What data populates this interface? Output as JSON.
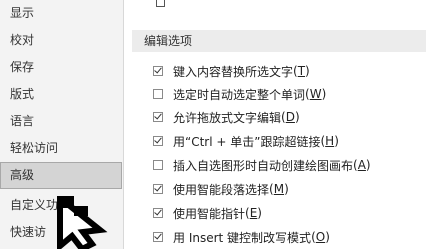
{
  "sidebar": {
    "items": [
      {
        "label": "显示",
        "selected": false
      },
      {
        "label": "校对",
        "selected": false
      },
      {
        "label": "保存",
        "selected": false
      },
      {
        "label": "版式",
        "selected": false
      },
      {
        "label": "语言",
        "selected": false
      },
      {
        "label": "轻松访问",
        "selected": false
      },
      {
        "label": "高级",
        "selected": true
      },
      {
        "label": "自定义功能",
        "selected": false
      },
      {
        "label": "快速访",
        "selected": false
      }
    ]
  },
  "main": {
    "section_title": "编辑选项",
    "options": [
      {
        "label": "键入内容替换所选文字",
        "key": "T",
        "checked": true
      },
      {
        "label": "选定时自动选定整个单词",
        "key": "W",
        "checked": false
      },
      {
        "label": "允许拖放式文字编辑",
        "key": "D",
        "checked": true
      },
      {
        "label": "用“Ctrl + 单击”跟踪超链接",
        "key": "H",
        "checked": true
      },
      {
        "label": "插入自选图形时自动创建绘图画布",
        "key": "A",
        "checked": false
      },
      {
        "label": "使用智能段落选择",
        "key": "M",
        "checked": true
      },
      {
        "label": "使用智能指针",
        "key": "E",
        "checked": true
      },
      {
        "label": "用 Insert 键控制改写模式",
        "key": "O",
        "checked": true
      }
    ]
  }
}
